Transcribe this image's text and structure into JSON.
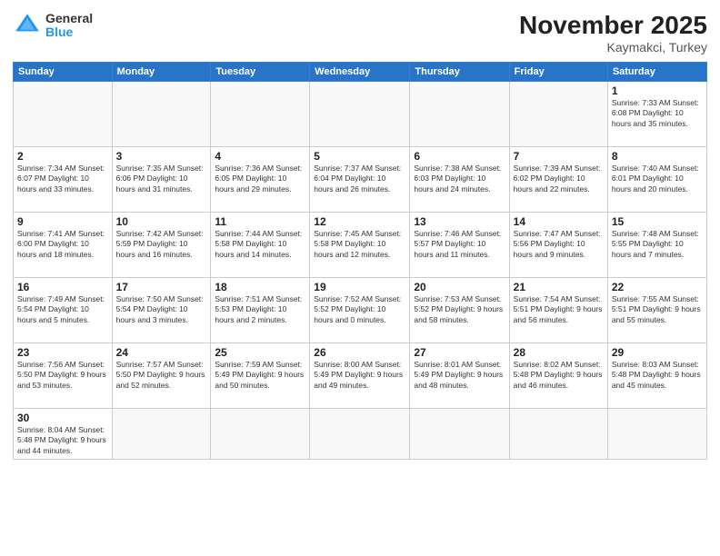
{
  "header": {
    "logo_general": "General",
    "logo_blue": "Blue",
    "month_title": "November 2025",
    "location": "Kaymakci, Turkey"
  },
  "days_of_week": [
    "Sunday",
    "Monday",
    "Tuesday",
    "Wednesday",
    "Thursday",
    "Friday",
    "Saturday"
  ],
  "weeks": [
    [
      {
        "day": "",
        "info": ""
      },
      {
        "day": "",
        "info": ""
      },
      {
        "day": "",
        "info": ""
      },
      {
        "day": "",
        "info": ""
      },
      {
        "day": "",
        "info": ""
      },
      {
        "day": "",
        "info": ""
      },
      {
        "day": "1",
        "info": "Sunrise: 7:33 AM\nSunset: 6:08 PM\nDaylight: 10 hours\nand 35 minutes."
      }
    ],
    [
      {
        "day": "2",
        "info": "Sunrise: 7:34 AM\nSunset: 6:07 PM\nDaylight: 10 hours\nand 33 minutes."
      },
      {
        "day": "3",
        "info": "Sunrise: 7:35 AM\nSunset: 6:06 PM\nDaylight: 10 hours\nand 31 minutes."
      },
      {
        "day": "4",
        "info": "Sunrise: 7:36 AM\nSunset: 6:05 PM\nDaylight: 10 hours\nand 29 minutes."
      },
      {
        "day": "5",
        "info": "Sunrise: 7:37 AM\nSunset: 6:04 PM\nDaylight: 10 hours\nand 26 minutes."
      },
      {
        "day": "6",
        "info": "Sunrise: 7:38 AM\nSunset: 6:03 PM\nDaylight: 10 hours\nand 24 minutes."
      },
      {
        "day": "7",
        "info": "Sunrise: 7:39 AM\nSunset: 6:02 PM\nDaylight: 10 hours\nand 22 minutes."
      },
      {
        "day": "8",
        "info": "Sunrise: 7:40 AM\nSunset: 6:01 PM\nDaylight: 10 hours\nand 20 minutes."
      }
    ],
    [
      {
        "day": "9",
        "info": "Sunrise: 7:41 AM\nSunset: 6:00 PM\nDaylight: 10 hours\nand 18 minutes."
      },
      {
        "day": "10",
        "info": "Sunrise: 7:42 AM\nSunset: 5:59 PM\nDaylight: 10 hours\nand 16 minutes."
      },
      {
        "day": "11",
        "info": "Sunrise: 7:44 AM\nSunset: 5:58 PM\nDaylight: 10 hours\nand 14 minutes."
      },
      {
        "day": "12",
        "info": "Sunrise: 7:45 AM\nSunset: 5:58 PM\nDaylight: 10 hours\nand 12 minutes."
      },
      {
        "day": "13",
        "info": "Sunrise: 7:46 AM\nSunset: 5:57 PM\nDaylight: 10 hours\nand 11 minutes."
      },
      {
        "day": "14",
        "info": "Sunrise: 7:47 AM\nSunset: 5:56 PM\nDaylight: 10 hours\nand 9 minutes."
      },
      {
        "day": "15",
        "info": "Sunrise: 7:48 AM\nSunset: 5:55 PM\nDaylight: 10 hours\nand 7 minutes."
      }
    ],
    [
      {
        "day": "16",
        "info": "Sunrise: 7:49 AM\nSunset: 5:54 PM\nDaylight: 10 hours\nand 5 minutes."
      },
      {
        "day": "17",
        "info": "Sunrise: 7:50 AM\nSunset: 5:54 PM\nDaylight: 10 hours\nand 3 minutes."
      },
      {
        "day": "18",
        "info": "Sunrise: 7:51 AM\nSunset: 5:53 PM\nDaylight: 10 hours\nand 2 minutes."
      },
      {
        "day": "19",
        "info": "Sunrise: 7:52 AM\nSunset: 5:52 PM\nDaylight: 10 hours\nand 0 minutes."
      },
      {
        "day": "20",
        "info": "Sunrise: 7:53 AM\nSunset: 5:52 PM\nDaylight: 9 hours\nand 58 minutes."
      },
      {
        "day": "21",
        "info": "Sunrise: 7:54 AM\nSunset: 5:51 PM\nDaylight: 9 hours\nand 56 minutes."
      },
      {
        "day": "22",
        "info": "Sunrise: 7:55 AM\nSunset: 5:51 PM\nDaylight: 9 hours\nand 55 minutes."
      }
    ],
    [
      {
        "day": "23",
        "info": "Sunrise: 7:56 AM\nSunset: 5:50 PM\nDaylight: 9 hours\nand 53 minutes."
      },
      {
        "day": "24",
        "info": "Sunrise: 7:57 AM\nSunset: 5:50 PM\nDaylight: 9 hours\nand 52 minutes."
      },
      {
        "day": "25",
        "info": "Sunrise: 7:59 AM\nSunset: 5:49 PM\nDaylight: 9 hours\nand 50 minutes."
      },
      {
        "day": "26",
        "info": "Sunrise: 8:00 AM\nSunset: 5:49 PM\nDaylight: 9 hours\nand 49 minutes."
      },
      {
        "day": "27",
        "info": "Sunrise: 8:01 AM\nSunset: 5:49 PM\nDaylight: 9 hours\nand 48 minutes."
      },
      {
        "day": "28",
        "info": "Sunrise: 8:02 AM\nSunset: 5:48 PM\nDaylight: 9 hours\nand 46 minutes."
      },
      {
        "day": "29",
        "info": "Sunrise: 8:03 AM\nSunset: 5:48 PM\nDaylight: 9 hours\nand 45 minutes."
      }
    ],
    [
      {
        "day": "30",
        "info": "Sunrise: 8:04 AM\nSunset: 5:48 PM\nDaylight: 9 hours\nand 44 minutes."
      },
      {
        "day": "",
        "info": ""
      },
      {
        "day": "",
        "info": ""
      },
      {
        "day": "",
        "info": ""
      },
      {
        "day": "",
        "info": ""
      },
      {
        "day": "",
        "info": ""
      },
      {
        "day": "",
        "info": ""
      }
    ]
  ]
}
